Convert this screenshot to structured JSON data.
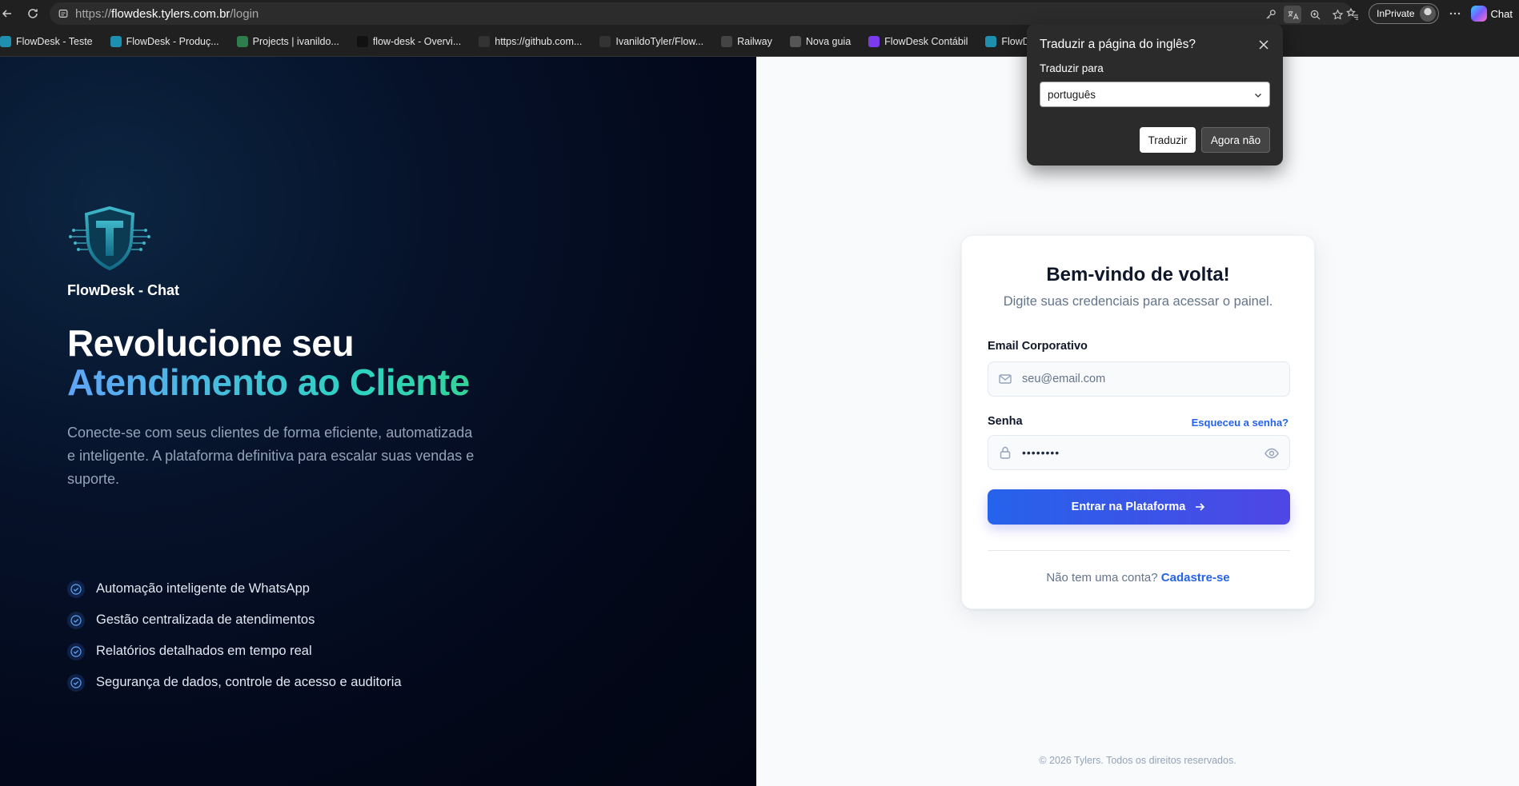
{
  "browser": {
    "url_prefix": "https://",
    "url_host": "flowdesk.tylers.com.br",
    "url_path": "/login",
    "inprivate_label": "InPrivate",
    "copilot_label": "Chat",
    "bookmarks": [
      {
        "label": "FlowDesk - Teste",
        "color": "#1f8fb0"
      },
      {
        "label": "FlowDesk - Produç...",
        "color": "#1f8fb0"
      },
      {
        "label": "Projects | ivanildo...",
        "color": "#2e7d4f"
      },
      {
        "label": "flow-desk - Overvi...",
        "color": "#111111"
      },
      {
        "label": "https://github.com...",
        "color": "#333333"
      },
      {
        "label": "IvanildoTyler/Flow...",
        "color": "#333333"
      },
      {
        "label": "Railway",
        "color": "#444444"
      },
      {
        "label": "Nova guia",
        "color": "#555555"
      },
      {
        "label": "FlowDesk Contábil",
        "color": "#7c3aed"
      },
      {
        "label": "FlowDesk",
        "color": "#1f8fb0"
      }
    ]
  },
  "translate_popup": {
    "title": "Traduzir a página do inglês?",
    "label": "Traduzir para",
    "selected_language": "português",
    "translate_button": "Traduzir",
    "dismiss_button": "Agora não"
  },
  "hero": {
    "brand_name": "FlowDesk - Chat",
    "headline_line1": "Revolucione seu",
    "headline_line2": "Atendimento ao Cliente",
    "subtitle": "Conecte-se com seus clientes de forma eficiente, automatizada e inteligente. A plataforma definitiva para escalar suas vendas e suporte.",
    "features": [
      "Automação inteligente de WhatsApp",
      "Gestão centralizada de atendimentos",
      "Relatórios detalhados em tempo real",
      "Segurança de dados, controle de acesso e auditoria"
    ]
  },
  "login": {
    "title": "Bem-vindo de volta!",
    "subtitle": "Digite suas credenciais para acessar o painel.",
    "email_label": "Email Corporativo",
    "email_placeholder": "seu@email.com",
    "password_label": "Senha",
    "forgot_link": "Esqueceu a senha?",
    "password_value": "••••••••",
    "submit_label": "Entrar na Plataforma",
    "signup_prompt": "Não tem uma conta?",
    "signup_link": "Cadastre-se"
  },
  "footer": {
    "text": "© 2026 Tylers. Todos os direitos reservados."
  },
  "colors": {
    "accent_blue": "#2563eb",
    "accent_indigo": "#4f46e5",
    "hero_gradient_start": "#60a5fa",
    "hero_gradient_end": "#34d399",
    "dark_panel": "#03081a"
  }
}
